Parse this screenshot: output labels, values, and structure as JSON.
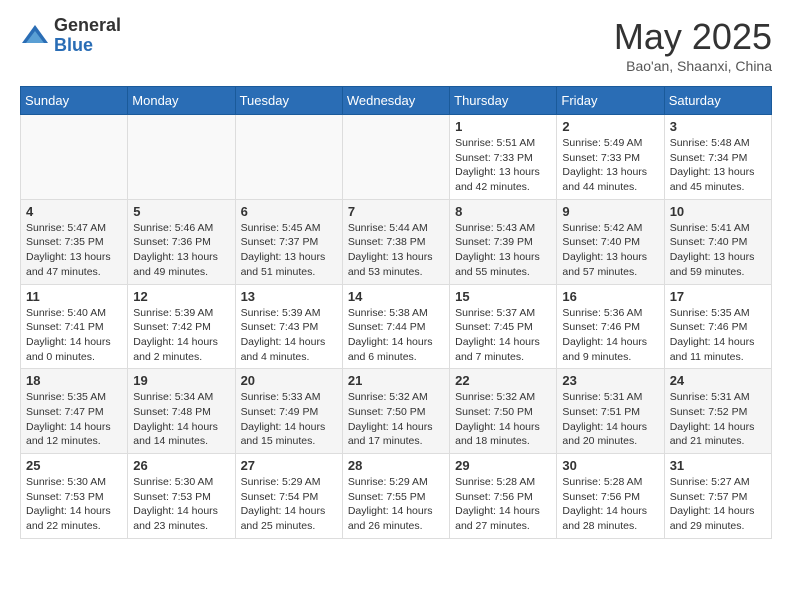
{
  "logo": {
    "general": "General",
    "blue": "Blue"
  },
  "title": "May 2025",
  "location": "Bao'an, Shaanxi, China",
  "days_of_week": [
    "Sunday",
    "Monday",
    "Tuesday",
    "Wednesday",
    "Thursday",
    "Friday",
    "Saturday"
  ],
  "weeks": [
    [
      {
        "day": "",
        "info": ""
      },
      {
        "day": "",
        "info": ""
      },
      {
        "day": "",
        "info": ""
      },
      {
        "day": "",
        "info": ""
      },
      {
        "day": "1",
        "info": "Sunrise: 5:51 AM\nSunset: 7:33 PM\nDaylight: 13 hours\nand 42 minutes."
      },
      {
        "day": "2",
        "info": "Sunrise: 5:49 AM\nSunset: 7:33 PM\nDaylight: 13 hours\nand 44 minutes."
      },
      {
        "day": "3",
        "info": "Sunrise: 5:48 AM\nSunset: 7:34 PM\nDaylight: 13 hours\nand 45 minutes."
      }
    ],
    [
      {
        "day": "4",
        "info": "Sunrise: 5:47 AM\nSunset: 7:35 PM\nDaylight: 13 hours\nand 47 minutes."
      },
      {
        "day": "5",
        "info": "Sunrise: 5:46 AM\nSunset: 7:36 PM\nDaylight: 13 hours\nand 49 minutes."
      },
      {
        "day": "6",
        "info": "Sunrise: 5:45 AM\nSunset: 7:37 PM\nDaylight: 13 hours\nand 51 minutes."
      },
      {
        "day": "7",
        "info": "Sunrise: 5:44 AM\nSunset: 7:38 PM\nDaylight: 13 hours\nand 53 minutes."
      },
      {
        "day": "8",
        "info": "Sunrise: 5:43 AM\nSunset: 7:39 PM\nDaylight: 13 hours\nand 55 minutes."
      },
      {
        "day": "9",
        "info": "Sunrise: 5:42 AM\nSunset: 7:40 PM\nDaylight: 13 hours\nand 57 minutes."
      },
      {
        "day": "10",
        "info": "Sunrise: 5:41 AM\nSunset: 7:40 PM\nDaylight: 13 hours\nand 59 minutes."
      }
    ],
    [
      {
        "day": "11",
        "info": "Sunrise: 5:40 AM\nSunset: 7:41 PM\nDaylight: 14 hours\nand 0 minutes."
      },
      {
        "day": "12",
        "info": "Sunrise: 5:39 AM\nSunset: 7:42 PM\nDaylight: 14 hours\nand 2 minutes."
      },
      {
        "day": "13",
        "info": "Sunrise: 5:39 AM\nSunset: 7:43 PM\nDaylight: 14 hours\nand 4 minutes."
      },
      {
        "day": "14",
        "info": "Sunrise: 5:38 AM\nSunset: 7:44 PM\nDaylight: 14 hours\nand 6 minutes."
      },
      {
        "day": "15",
        "info": "Sunrise: 5:37 AM\nSunset: 7:45 PM\nDaylight: 14 hours\nand 7 minutes."
      },
      {
        "day": "16",
        "info": "Sunrise: 5:36 AM\nSunset: 7:46 PM\nDaylight: 14 hours\nand 9 minutes."
      },
      {
        "day": "17",
        "info": "Sunrise: 5:35 AM\nSunset: 7:46 PM\nDaylight: 14 hours\nand 11 minutes."
      }
    ],
    [
      {
        "day": "18",
        "info": "Sunrise: 5:35 AM\nSunset: 7:47 PM\nDaylight: 14 hours\nand 12 minutes."
      },
      {
        "day": "19",
        "info": "Sunrise: 5:34 AM\nSunset: 7:48 PM\nDaylight: 14 hours\nand 14 minutes."
      },
      {
        "day": "20",
        "info": "Sunrise: 5:33 AM\nSunset: 7:49 PM\nDaylight: 14 hours\nand 15 minutes."
      },
      {
        "day": "21",
        "info": "Sunrise: 5:32 AM\nSunset: 7:50 PM\nDaylight: 14 hours\nand 17 minutes."
      },
      {
        "day": "22",
        "info": "Sunrise: 5:32 AM\nSunset: 7:50 PM\nDaylight: 14 hours\nand 18 minutes."
      },
      {
        "day": "23",
        "info": "Sunrise: 5:31 AM\nSunset: 7:51 PM\nDaylight: 14 hours\nand 20 minutes."
      },
      {
        "day": "24",
        "info": "Sunrise: 5:31 AM\nSunset: 7:52 PM\nDaylight: 14 hours\nand 21 minutes."
      }
    ],
    [
      {
        "day": "25",
        "info": "Sunrise: 5:30 AM\nSunset: 7:53 PM\nDaylight: 14 hours\nand 22 minutes."
      },
      {
        "day": "26",
        "info": "Sunrise: 5:30 AM\nSunset: 7:53 PM\nDaylight: 14 hours\nand 23 minutes."
      },
      {
        "day": "27",
        "info": "Sunrise: 5:29 AM\nSunset: 7:54 PM\nDaylight: 14 hours\nand 25 minutes."
      },
      {
        "day": "28",
        "info": "Sunrise: 5:29 AM\nSunset: 7:55 PM\nDaylight: 14 hours\nand 26 minutes."
      },
      {
        "day": "29",
        "info": "Sunrise: 5:28 AM\nSunset: 7:56 PM\nDaylight: 14 hours\nand 27 minutes."
      },
      {
        "day": "30",
        "info": "Sunrise: 5:28 AM\nSunset: 7:56 PM\nDaylight: 14 hours\nand 28 minutes."
      },
      {
        "day": "31",
        "info": "Sunrise: 5:27 AM\nSunset: 7:57 PM\nDaylight: 14 hours\nand 29 minutes."
      }
    ]
  ]
}
